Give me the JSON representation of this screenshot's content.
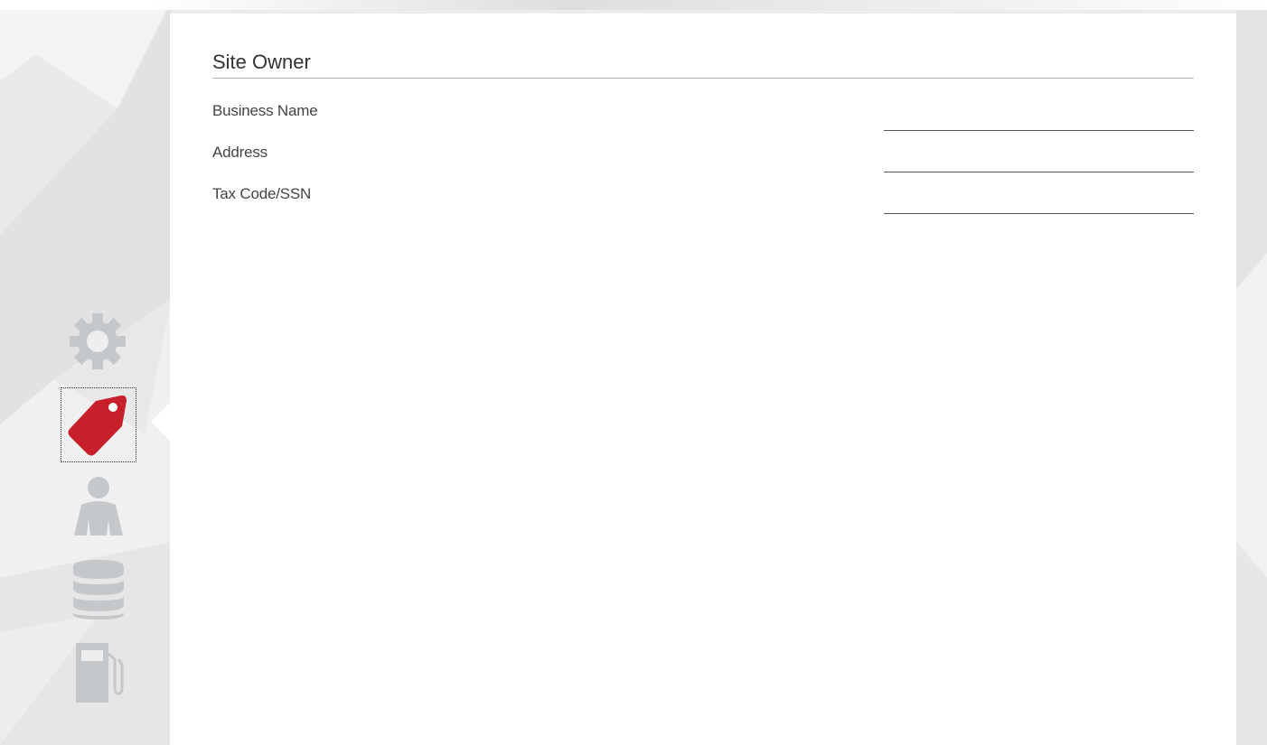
{
  "form": {
    "section_title": "Site Owner",
    "fields": [
      {
        "label": "Business Name",
        "value": ""
      },
      {
        "label": "Address",
        "value": ""
      },
      {
        "label": "Tax Code/SSN",
        "value": ""
      }
    ]
  },
  "sidebar": {
    "items": [
      {
        "icon": "gear-icon",
        "active": false
      },
      {
        "icon": "tag-icon",
        "active": true
      },
      {
        "icon": "user-icon",
        "active": false
      },
      {
        "icon": "database-icon",
        "active": false
      },
      {
        "icon": "fuel-pump-icon",
        "active": false
      }
    ]
  },
  "colors": {
    "active_icon": "#c8202a",
    "inactive_icon": "#c5c8cb",
    "panel_background": "#ffffff"
  }
}
